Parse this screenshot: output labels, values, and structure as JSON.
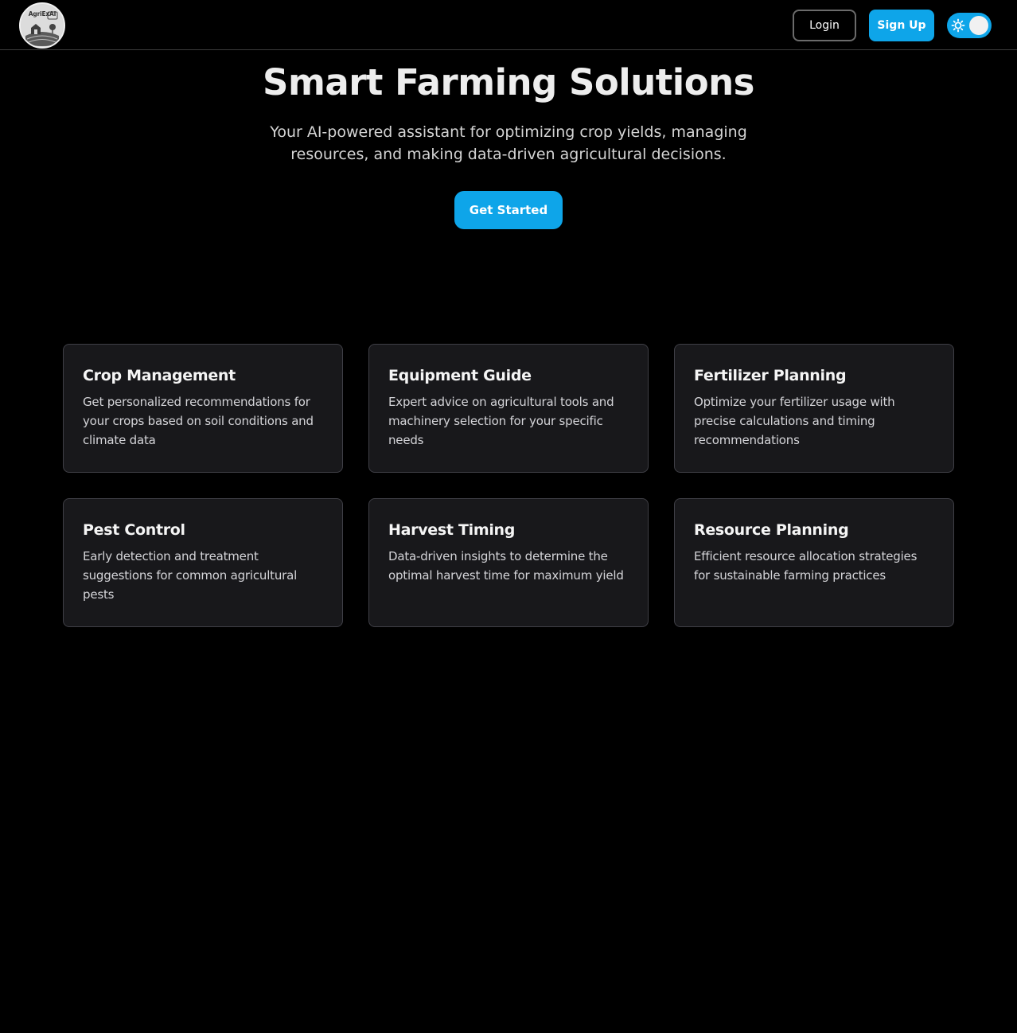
{
  "header": {
    "logo_text": "AgriExAI",
    "login_label": "Login",
    "signup_label": "Sign Up",
    "theme_toggle_icon": "sun-icon"
  },
  "hero": {
    "title": "Smart Farming Solutions",
    "subtitle": "Your AI-powered assistant for optimizing crop yields, managing resources, and making data-driven agricultural decisions.",
    "cta_label": "Get Started"
  },
  "features": [
    {
      "title": "Crop Management",
      "description": "Get personalized recommendations for your crops based on soil conditions and climate data"
    },
    {
      "title": "Equipment Guide",
      "description": "Expert advice on agricultural tools and machinery selection for your specific needs"
    },
    {
      "title": "Fertilizer Planning",
      "description": "Optimize your fertilizer usage with precise calculations and timing recommendations"
    },
    {
      "title": "Pest Control",
      "description": "Early detection and treatment suggestions for common agricultural pests"
    },
    {
      "title": "Harvest Timing",
      "description": "Data-driven insights to determine the optimal harvest time for maximum yield"
    },
    {
      "title": "Resource Planning",
      "description": "Efficient resource allocation strategies for sustainable farming practices"
    }
  ],
  "colors": {
    "background": "#000000",
    "accent": "#0ea5e9",
    "card_background": "#18181b",
    "card_border": "#3f3f46"
  }
}
